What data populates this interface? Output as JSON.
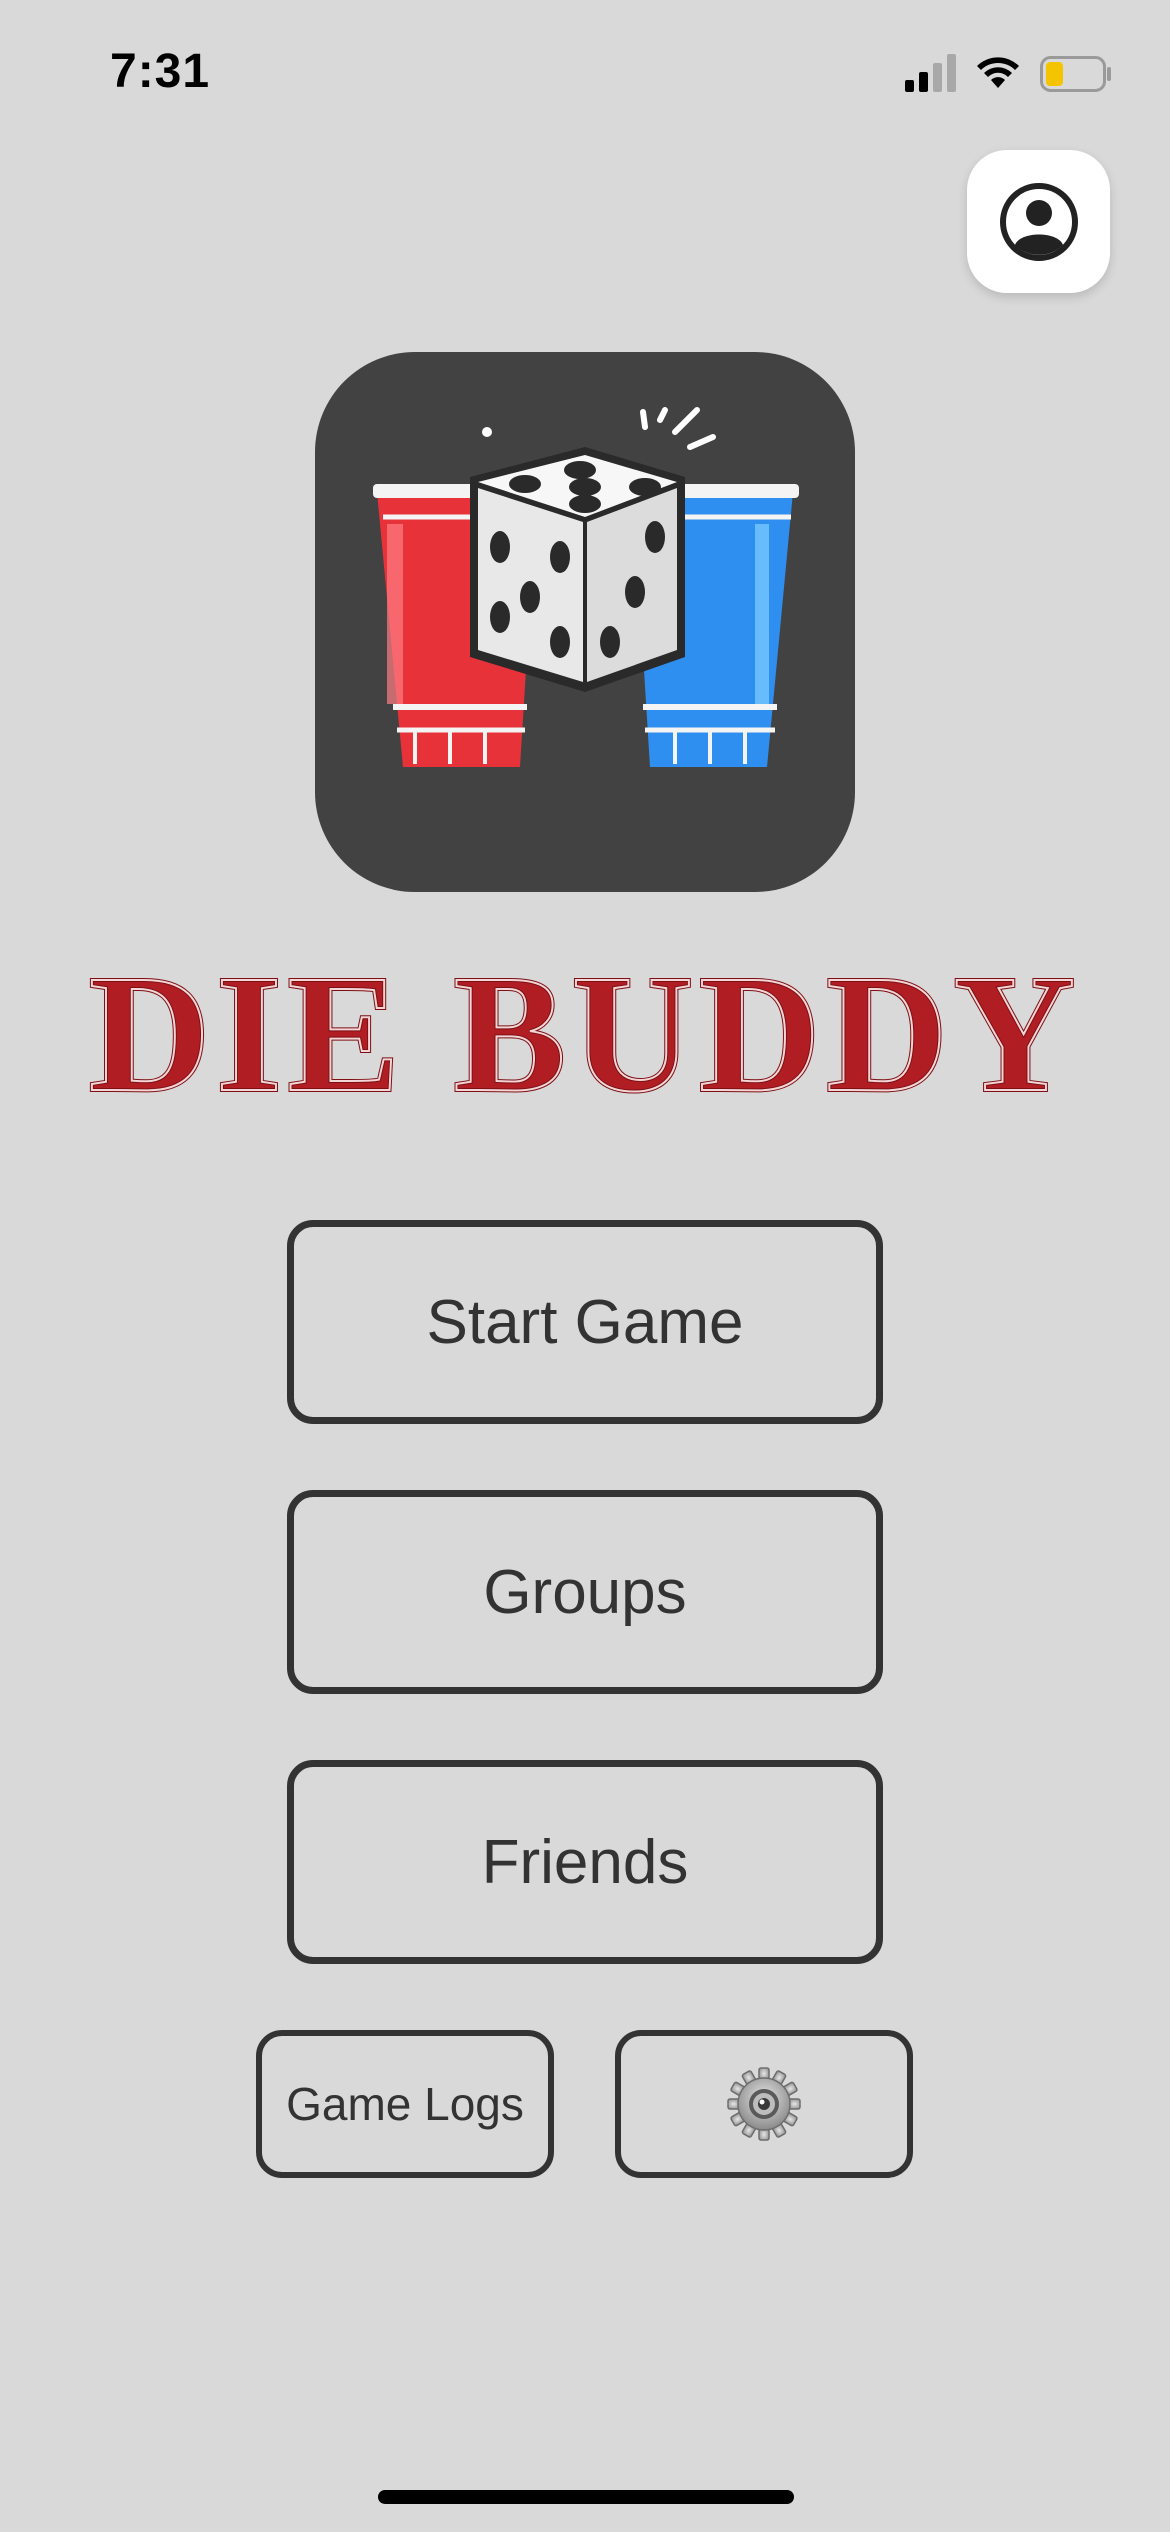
{
  "status_bar": {
    "time": "7:31"
  },
  "icons": {
    "profile": "person-circle-icon",
    "settings": "gear-icon",
    "signal": "cellular-signal-icon",
    "wifi": "wifi-icon",
    "battery": "battery-icon"
  },
  "app": {
    "title": "DIE BUDDY"
  },
  "menu": {
    "start_game": "Start Game",
    "groups": "Groups",
    "friends": "Friends",
    "game_logs": "Game Logs"
  },
  "colors": {
    "background": "#d9d9d9",
    "button_border": "#333333",
    "title_red": "#b01e23",
    "logo_bg": "#424242",
    "cup_red": "#e8323a",
    "cup_blue": "#2f8ff0",
    "battery_fill": "#f5c400"
  }
}
